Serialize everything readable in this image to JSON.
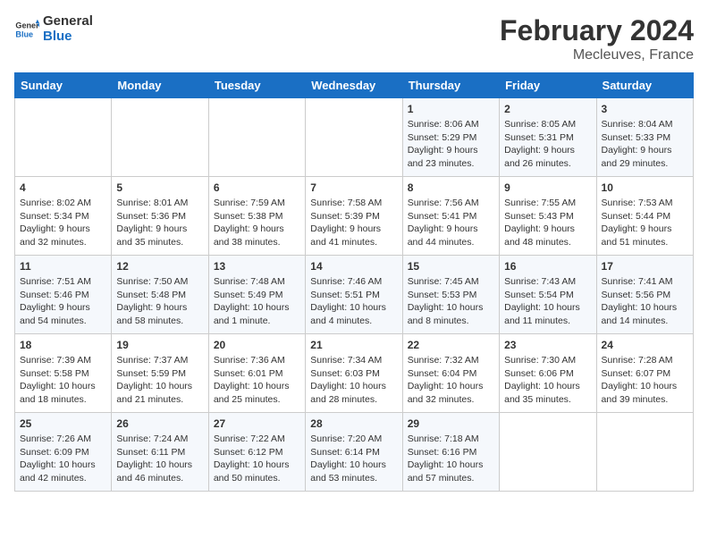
{
  "header": {
    "logo_general": "General",
    "logo_blue": "Blue",
    "month_title": "February 2024",
    "location": "Mecleuves, France"
  },
  "columns": [
    "Sunday",
    "Monday",
    "Tuesday",
    "Wednesday",
    "Thursday",
    "Friday",
    "Saturday"
  ],
  "weeks": [
    {
      "days": [
        {
          "number": "",
          "content": "",
          "empty": true
        },
        {
          "number": "",
          "content": "",
          "empty": true
        },
        {
          "number": "",
          "content": "",
          "empty": true
        },
        {
          "number": "",
          "content": "",
          "empty": true
        },
        {
          "number": "1",
          "content": "Sunrise: 8:06 AM\nSunset: 5:29 PM\nDaylight: 9 hours\nand 23 minutes."
        },
        {
          "number": "2",
          "content": "Sunrise: 8:05 AM\nSunset: 5:31 PM\nDaylight: 9 hours\nand 26 minutes."
        },
        {
          "number": "3",
          "content": "Sunrise: 8:04 AM\nSunset: 5:33 PM\nDaylight: 9 hours\nand 29 minutes."
        }
      ]
    },
    {
      "days": [
        {
          "number": "4",
          "content": "Sunrise: 8:02 AM\nSunset: 5:34 PM\nDaylight: 9 hours\nand 32 minutes."
        },
        {
          "number": "5",
          "content": "Sunrise: 8:01 AM\nSunset: 5:36 PM\nDaylight: 9 hours\nand 35 minutes."
        },
        {
          "number": "6",
          "content": "Sunrise: 7:59 AM\nSunset: 5:38 PM\nDaylight: 9 hours\nand 38 minutes."
        },
        {
          "number": "7",
          "content": "Sunrise: 7:58 AM\nSunset: 5:39 PM\nDaylight: 9 hours\nand 41 minutes."
        },
        {
          "number": "8",
          "content": "Sunrise: 7:56 AM\nSunset: 5:41 PM\nDaylight: 9 hours\nand 44 minutes."
        },
        {
          "number": "9",
          "content": "Sunrise: 7:55 AM\nSunset: 5:43 PM\nDaylight: 9 hours\nand 48 minutes."
        },
        {
          "number": "10",
          "content": "Sunrise: 7:53 AM\nSunset: 5:44 PM\nDaylight: 9 hours\nand 51 minutes."
        }
      ]
    },
    {
      "days": [
        {
          "number": "11",
          "content": "Sunrise: 7:51 AM\nSunset: 5:46 PM\nDaylight: 9 hours\nand 54 minutes."
        },
        {
          "number": "12",
          "content": "Sunrise: 7:50 AM\nSunset: 5:48 PM\nDaylight: 9 hours\nand 58 minutes."
        },
        {
          "number": "13",
          "content": "Sunrise: 7:48 AM\nSunset: 5:49 PM\nDaylight: 10 hours\nand 1 minute."
        },
        {
          "number": "14",
          "content": "Sunrise: 7:46 AM\nSunset: 5:51 PM\nDaylight: 10 hours\nand 4 minutes."
        },
        {
          "number": "15",
          "content": "Sunrise: 7:45 AM\nSunset: 5:53 PM\nDaylight: 10 hours\nand 8 minutes."
        },
        {
          "number": "16",
          "content": "Sunrise: 7:43 AM\nSunset: 5:54 PM\nDaylight: 10 hours\nand 11 minutes."
        },
        {
          "number": "17",
          "content": "Sunrise: 7:41 AM\nSunset: 5:56 PM\nDaylight: 10 hours\nand 14 minutes."
        }
      ]
    },
    {
      "days": [
        {
          "number": "18",
          "content": "Sunrise: 7:39 AM\nSunset: 5:58 PM\nDaylight: 10 hours\nand 18 minutes."
        },
        {
          "number": "19",
          "content": "Sunrise: 7:37 AM\nSunset: 5:59 PM\nDaylight: 10 hours\nand 21 minutes."
        },
        {
          "number": "20",
          "content": "Sunrise: 7:36 AM\nSunset: 6:01 PM\nDaylight: 10 hours\nand 25 minutes."
        },
        {
          "number": "21",
          "content": "Sunrise: 7:34 AM\nSunset: 6:03 PM\nDaylight: 10 hours\nand 28 minutes."
        },
        {
          "number": "22",
          "content": "Sunrise: 7:32 AM\nSunset: 6:04 PM\nDaylight: 10 hours\nand 32 minutes."
        },
        {
          "number": "23",
          "content": "Sunrise: 7:30 AM\nSunset: 6:06 PM\nDaylight: 10 hours\nand 35 minutes."
        },
        {
          "number": "24",
          "content": "Sunrise: 7:28 AM\nSunset: 6:07 PM\nDaylight: 10 hours\nand 39 minutes."
        }
      ]
    },
    {
      "days": [
        {
          "number": "25",
          "content": "Sunrise: 7:26 AM\nSunset: 6:09 PM\nDaylight: 10 hours\nand 42 minutes."
        },
        {
          "number": "26",
          "content": "Sunrise: 7:24 AM\nSunset: 6:11 PM\nDaylight: 10 hours\nand 46 minutes."
        },
        {
          "number": "27",
          "content": "Sunrise: 7:22 AM\nSunset: 6:12 PM\nDaylight: 10 hours\nand 50 minutes."
        },
        {
          "number": "28",
          "content": "Sunrise: 7:20 AM\nSunset: 6:14 PM\nDaylight: 10 hours\nand 53 minutes."
        },
        {
          "number": "29",
          "content": "Sunrise: 7:18 AM\nSunset: 6:16 PM\nDaylight: 10 hours\nand 57 minutes."
        },
        {
          "number": "",
          "content": "",
          "empty": true
        },
        {
          "number": "",
          "content": "",
          "empty": true
        }
      ]
    }
  ]
}
